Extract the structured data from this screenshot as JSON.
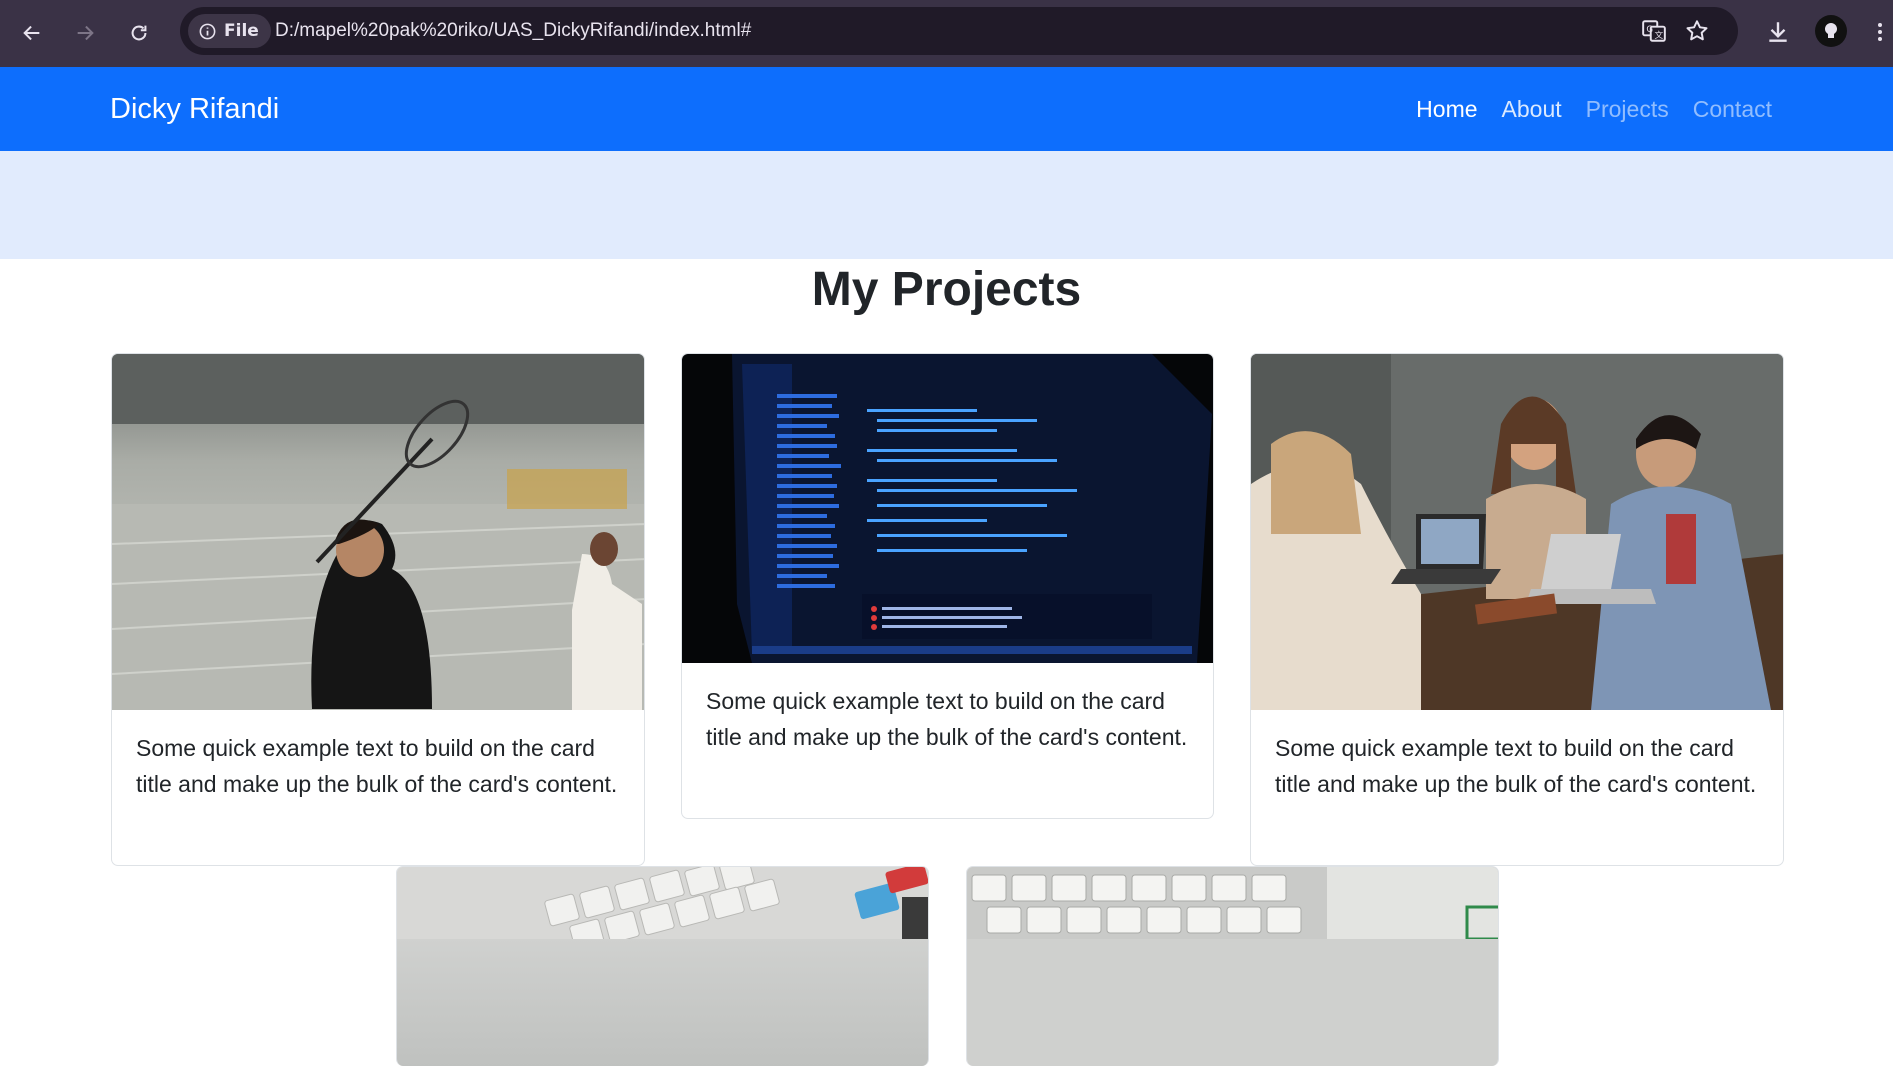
{
  "browser": {
    "file_label": "File",
    "url": "D:/mapel%20pak%20riko/UAS_DickyRifandi/index.html#"
  },
  "navbar": {
    "brand": "Dicky Rifandi",
    "links": [
      {
        "label": "Home"
      },
      {
        "label": "About"
      },
      {
        "label": "Projects"
      },
      {
        "label": "Contact"
      }
    ]
  },
  "projects": {
    "title": "My Projects",
    "cards": [
      {
        "image": "badminton-photo",
        "text": "Some quick example text to build on the card title and make up the bulk of the card's content."
      },
      {
        "image": "code-editor-photo",
        "text": "Some quick example text to build on the card title and make up the bulk of the card's content."
      },
      {
        "image": "team-laptop-photo",
        "text": "Some quick example text to build on the card title and make up the bulk of the card's content."
      },
      {
        "image": "keyboard-photo"
      },
      {
        "image": "keyboard-photo"
      }
    ]
  },
  "colors": {
    "primary": "#0d6efd",
    "hero_bg": "#e1ebfd",
    "chrome_bg": "#3a3246"
  }
}
